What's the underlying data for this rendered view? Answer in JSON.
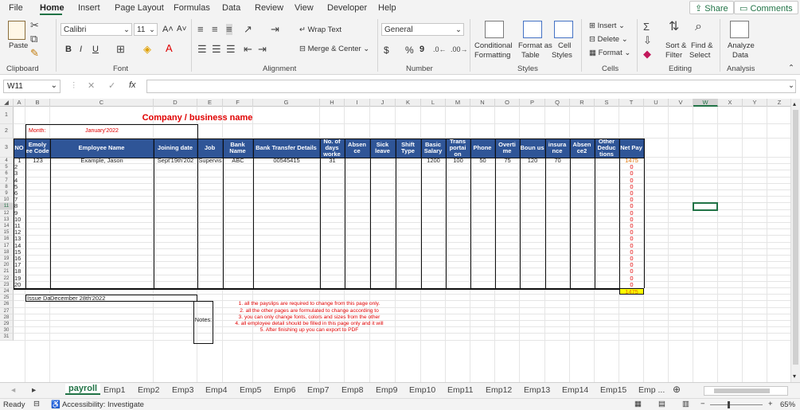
{
  "menu": {
    "tabs": [
      "File",
      "Home",
      "Insert",
      "Page Layout",
      "Formulas",
      "Data",
      "Review",
      "View",
      "Developer",
      "Help"
    ],
    "active": "Home",
    "share": "Share",
    "comments": "Comments"
  },
  "ribbon": {
    "clipboard": {
      "label": "Clipboard",
      "paste": "Paste"
    },
    "font": {
      "label": "Font",
      "name": "Calibri",
      "size": "11",
      "bold": "B",
      "italic": "I",
      "underline": "U"
    },
    "alignment": {
      "label": "Alignment",
      "wrap": "Wrap Text",
      "merge": "Merge & Center"
    },
    "number": {
      "label": "Number",
      "format": "General",
      "currency": "$",
      "percent": "%",
      "comma": "9"
    },
    "styles": {
      "label": "Styles",
      "conditional_1": "Conditional",
      "conditional_2": "Formatting",
      "format_table_1": "Format as",
      "format_table_2": "Table",
      "cell_styles_1": "Cell",
      "cell_styles_2": "Styles"
    },
    "cells": {
      "label": "Cells",
      "insert": "Insert",
      "delete": "Delete",
      "format": "Format"
    },
    "editing": {
      "label": "Editing",
      "sort_1": "Sort &",
      "sort_2": "Filter",
      "find_1": "Find &",
      "find_2": "Select"
    },
    "analysis": {
      "label": "Analysis",
      "analyze_1": "Analyze",
      "analyze_2": "Data"
    }
  },
  "formula_bar": {
    "name_box": "W11",
    "fx": "fx",
    "value": ""
  },
  "columns": [
    "A",
    "B",
    "C",
    "D",
    "E",
    "F",
    "G",
    "H",
    "I",
    "J",
    "K",
    "L",
    "M",
    "N",
    "O",
    "P",
    "Q",
    "R",
    "S",
    "T",
    "U",
    "V",
    "W",
    "X",
    "Y",
    "Z"
  ],
  "sheet": {
    "title": "Company / business name",
    "month_label": "Month:",
    "month_value": "January'2022",
    "headers": [
      "NO",
      "Emoly ee Code",
      "Employee Name",
      "Joining date",
      "Job",
      "Bank Name",
      "Bank Transfer Details",
      "No. of days worke",
      "Absen ce",
      "Sick leave",
      "Shift Type",
      "Basic Salary",
      "Trans portai on",
      "Phone",
      "Overti me",
      "Boun us",
      "insura nce",
      "Absen ce2",
      "Other Deduc tions",
      "Net Pay"
    ],
    "row1": {
      "no": "1",
      "code": "123",
      "name": "Example, Jason",
      "joining": "Sept'19th'202",
      "job": "Supervis",
      "bank": "ABC",
      "transfer": "00545415",
      "days": "31",
      "basic": "1200",
      "transport": "100",
      "phone": "50",
      "overtime": "75",
      "bonus": "120",
      "insurance": "70",
      "net": "1475"
    },
    "numbers": [
      "2",
      "3",
      "4",
      "5",
      "6",
      "7",
      "8",
      "9",
      "10",
      "11",
      "12",
      "13",
      "14",
      "15",
      "16",
      "17",
      "18",
      "19",
      "20"
    ],
    "net_zero": "0",
    "total": "1475",
    "issue_label": "Issue Dat",
    "issue_value": "December 28th'2022",
    "notes_label": "Notes:",
    "notes": [
      "1. all the payslips are required to change from this page only.",
      "2. all the other pages are formulated to change according to",
      "3. you can only change fonts, colors and sizes from the other",
      "4. all employee detail should be filled in this page only and it will",
      "5. After finishing up you can export to PDF"
    ]
  },
  "row_numbers": [
    "1",
    "2",
    "3",
    "4",
    "5",
    "6",
    "7",
    "8",
    "9",
    "10",
    "11",
    "12",
    "13",
    "14",
    "15",
    "16",
    "17",
    "18",
    "19",
    "20",
    "21",
    "22",
    "23",
    "24",
    "25",
    "26",
    "27",
    "28",
    "29",
    "30",
    "31"
  ],
  "sheet_tabs": [
    "payroll",
    "Emp1",
    "Emp2",
    "Emp3",
    "Emp4",
    "Emp5",
    "Emp6",
    "Emp7",
    "Emp8",
    "Emp9",
    "Emp10",
    "Emp11",
    "Emp12",
    "Emp13",
    "Emp14",
    "Emp15",
    "Emp ..."
  ],
  "status": {
    "ready": "Ready",
    "accessibility": "Accessibility: Investigate",
    "zoom": "65%"
  },
  "colors": {
    "accent": "#217346",
    "header_fill": "#2f5597",
    "total_fill": "#ffff00",
    "red_text": "#e00000"
  }
}
